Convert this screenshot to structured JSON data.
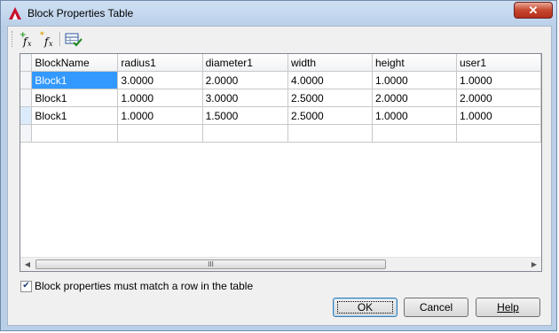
{
  "window": {
    "title": "Block Properties Table"
  },
  "toolbar": {
    "buttons": [
      "add-property-icon",
      "new-user-parameter-icon",
      "link-verify-icon"
    ]
  },
  "grid": {
    "columns": [
      "BlockName",
      "radius1",
      "diameter1",
      "width",
      "height",
      "user1"
    ],
    "rows": [
      [
        "Block1",
        "3.0000",
        "2.0000",
        "4.0000",
        "1.0000",
        "1.0000"
      ],
      [
        "Block1",
        "1.0000",
        "3.0000",
        "2.5000",
        "2.0000",
        "2.0000"
      ],
      [
        "Block1",
        "1.0000",
        "1.5000",
        "2.5000",
        "1.0000",
        "1.0000"
      ],
      [
        "",
        "",
        "",
        "",
        "",
        ""
      ]
    ]
  },
  "scrollbar": {
    "thumb_glyph": "III"
  },
  "options": {
    "match_row_label": "Block properties must match a row in the table",
    "match_row_checked": true
  },
  "buttons": {
    "ok": "OK",
    "cancel": "Cancel",
    "help": "Help"
  },
  "colors": {
    "selection": "#3399ff",
    "close_button": "#c7462e"
  }
}
